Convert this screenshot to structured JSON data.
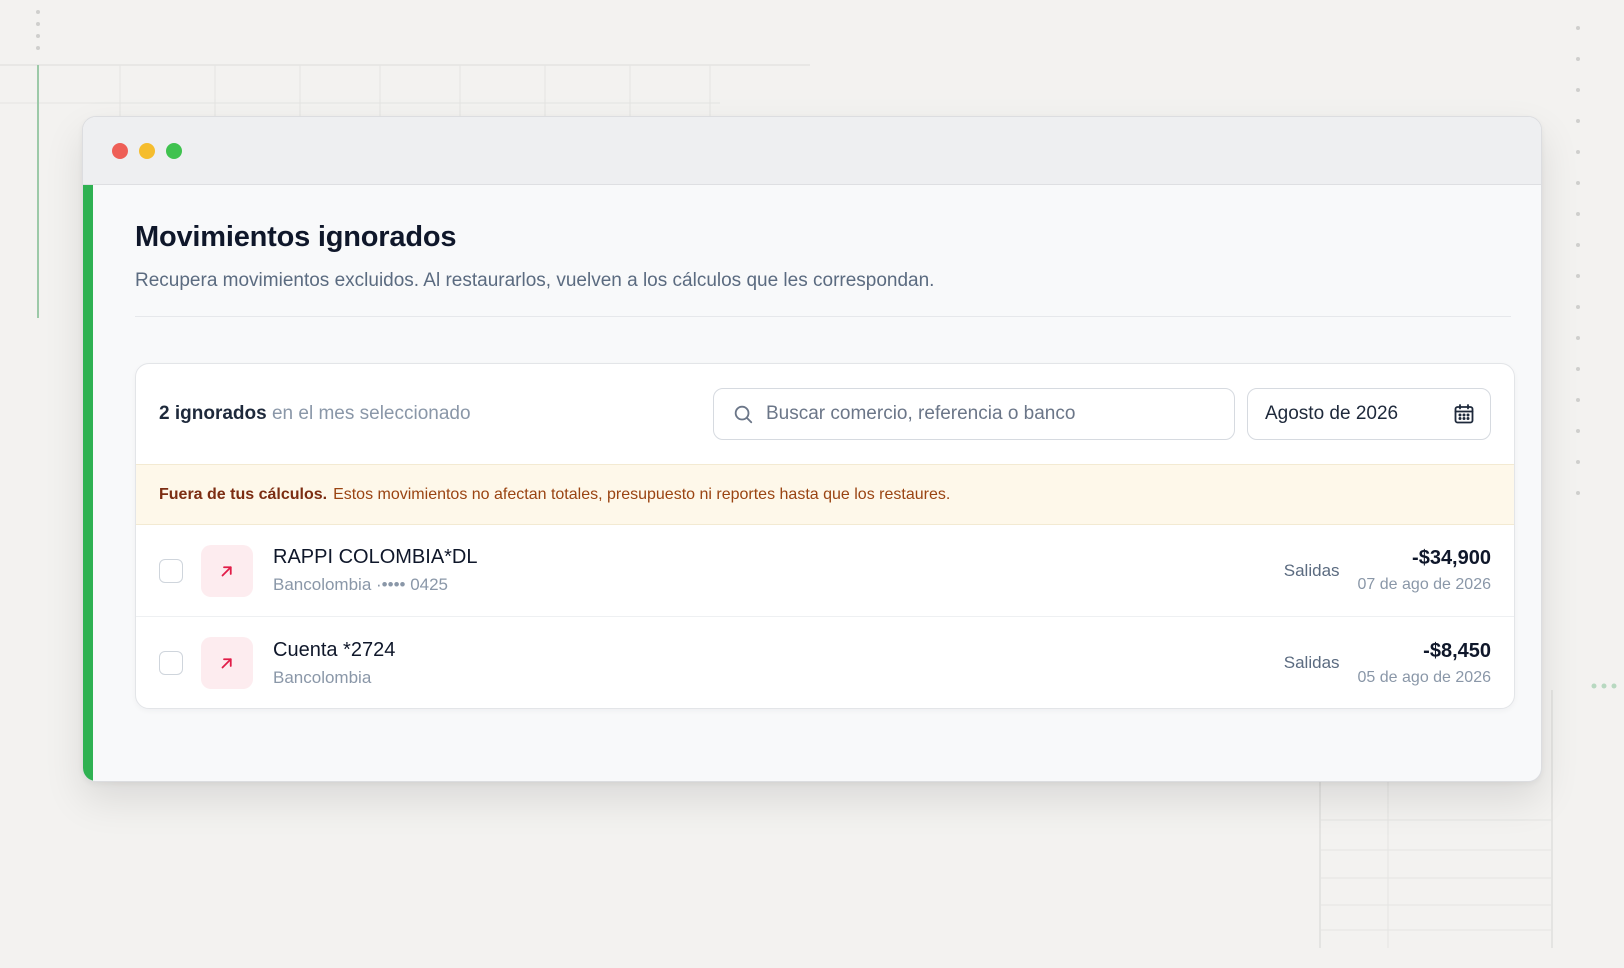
{
  "window": {
    "controls": [
      {
        "name": "close",
        "color": "#ee5f57"
      },
      {
        "name": "minimize",
        "color": "#f5bd2e"
      },
      {
        "name": "maximize",
        "color": "#3fc24f"
      }
    ],
    "accent_color": "#2fb152"
  },
  "page": {
    "title": "Movimientos ignorados",
    "subtitle": "Recupera movimientos excluidos. Al restaurarlos, vuelven a los cálculos que les correspondan."
  },
  "summary": {
    "count_label": "2 ignorados",
    "suffix": "en el mes seleccionado"
  },
  "search": {
    "icon": "search-icon",
    "placeholder": "Buscar comercio, referencia o banco"
  },
  "month_picker": {
    "value": "Agosto de 2026",
    "icon": "calendar-icon"
  },
  "notice": {
    "strong": "Fuera de tus cálculos.",
    "text": "Estos movimientos no afectan totales, presupuesto ni reportes hasta que los restaures."
  },
  "transactions": [
    {
      "merchant": "RAPPI COLOMBIA*DL",
      "account": "Bancolombia ·•••• 0425",
      "kind": "Salidas",
      "amount": "-$34,900",
      "date": "07 de ago de 2026",
      "icon": "arrow-up-right-icon",
      "checked": false
    },
    {
      "merchant": "Cuenta *2724",
      "account": "Bancolombia",
      "kind": "Salidas",
      "amount": "-$8,450",
      "date": "05 de ago de 2026",
      "icon": "arrow-up-right-icon",
      "checked": false
    }
  ],
  "colors": {
    "expense_icon": "#e11d48",
    "expense_icon_bg": "#fdecef",
    "notice_bg": "#fef8ea",
    "notice_text": "#9a4412"
  }
}
